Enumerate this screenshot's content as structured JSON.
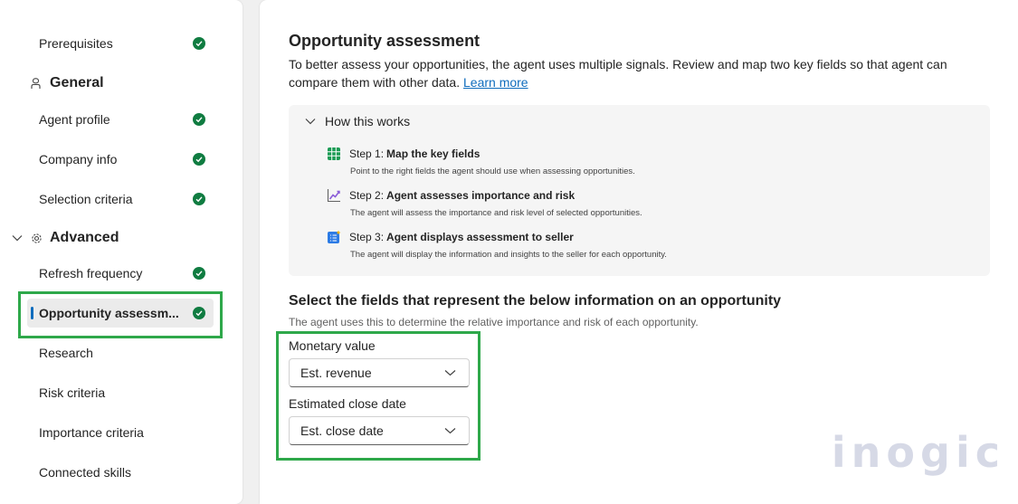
{
  "sidebar": {
    "items": [
      {
        "label": "Prerequisites",
        "done": true
      },
      {
        "label": "Agent profile",
        "done": true
      },
      {
        "label": "Company info",
        "done": true
      },
      {
        "label": "Selection criteria",
        "done": true
      },
      {
        "label": "Refresh frequency",
        "done": true
      },
      {
        "label": "Opportunity assessm...",
        "done": true,
        "selected": true
      },
      {
        "label": "Research",
        "done": false
      },
      {
        "label": "Risk criteria",
        "done": false
      },
      {
        "label": "Importance criteria",
        "done": false
      },
      {
        "label": "Connected skills",
        "done": false
      }
    ],
    "groups": {
      "general": {
        "label": "General",
        "icon": "person-icon"
      },
      "advanced": {
        "label": "Advanced",
        "icon": "gear-icon"
      }
    }
  },
  "main": {
    "title": "Opportunity assessment",
    "description": "To better assess your opportunities, the agent uses multiple signals. Review and map two key fields so that agent can compare them with other data.",
    "learn_more": "Learn more",
    "how_it_works": {
      "header": "How this works",
      "steps": [
        {
          "num": "Step 1:",
          "title": "Map the key fields",
          "sub": "Point to the right fields the agent should use when assessing opportunities.",
          "icon": "table-icon"
        },
        {
          "num": "Step 2:",
          "title": "Agent assesses importance and risk",
          "sub": "The agent will assess the importance and risk level of selected opportunities.",
          "icon": "trend-icon"
        },
        {
          "num": "Step 3:",
          "title": "Agent displays assessment to seller",
          "sub": "The agent will display the information and insights to the seller for each opportunity.",
          "icon": "list-sparkle-icon"
        }
      ]
    },
    "fields_section": {
      "title": "Select the fields that represent the below information on an opportunity",
      "subtitle": "The agent uses this to determine the relative importance and risk of each opportunity.",
      "monetary_label": "Monetary value",
      "monetary_value": "Est. revenue",
      "close_label": "Estimated close date",
      "close_value": "Est. close date"
    }
  },
  "watermark": "inogic",
  "colors": {
    "accent": "#0f6cbd",
    "success": "#107c41",
    "highlight": "#2ea84a"
  }
}
